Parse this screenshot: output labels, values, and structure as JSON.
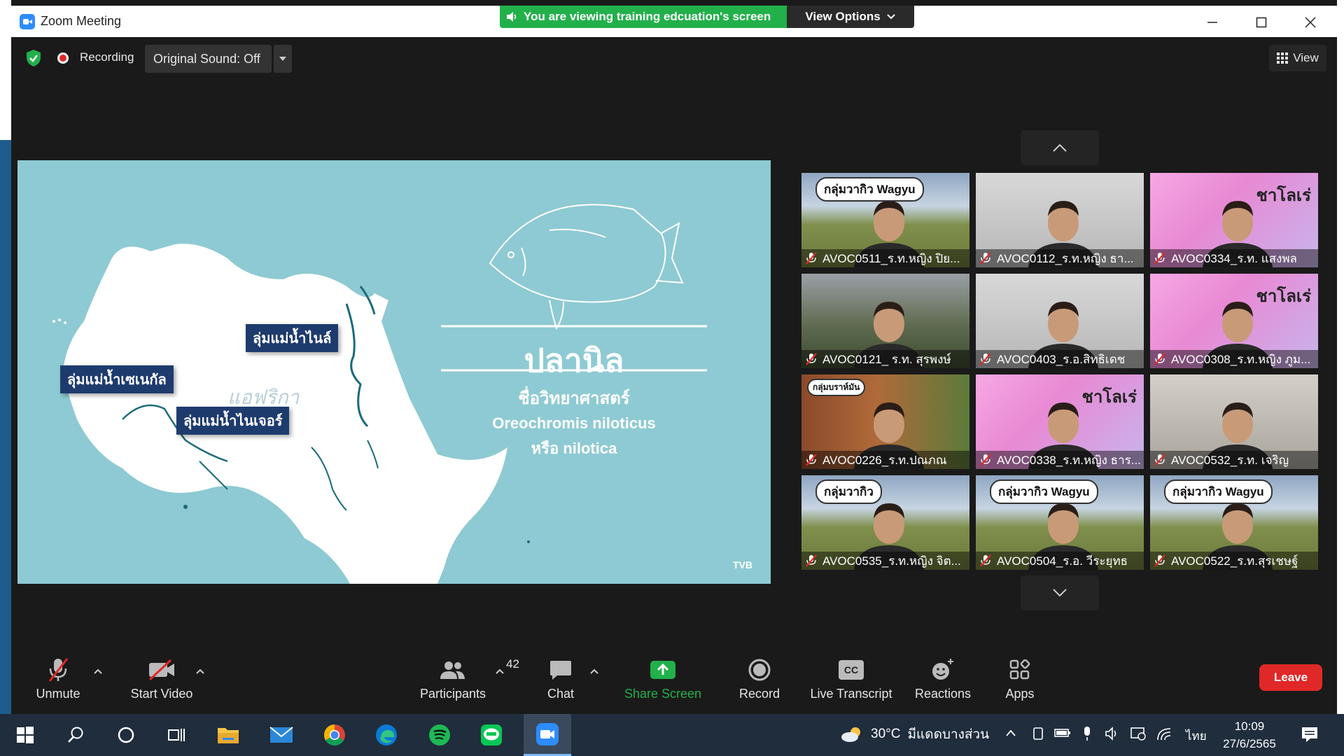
{
  "window": {
    "title": "Zoom Meeting",
    "controls": [
      "minimize",
      "maximize",
      "close"
    ]
  },
  "banner": {
    "viewing_text": "You are viewing training edcuation's screen",
    "view_options_label": "View Options"
  },
  "top_toolbar": {
    "recording_label": "Recording",
    "original_sound_label": "Original Sound: Off",
    "view_label": "View"
  },
  "shared_slide": {
    "map_labels": [
      "ลุ่มแม่น้ำไนล์",
      "ลุ่มแม่น้ำเซเนกัล",
      "ลุ่มแม่น้ำไนเจอร์"
    ],
    "region_label": "แอฟริกา",
    "fish_name": "ปลานิล",
    "sci_heading": "ชื่อวิทยาศาสตร์",
    "sci_name_1": "Oreochromis niloticus",
    "sci_name_2": "หรือ nilotica",
    "watermark": "TVB"
  },
  "gallery": {
    "participants": [
      {
        "name": "AVOC0511_ร.ท.หญิง ปิย...",
        "bg": "wagyu",
        "sign": "กลุ่มวากิว Wagyu"
      },
      {
        "name": "AVOC0112_ร.ท.หญิง ธา...",
        "bg": "room",
        "sign": ""
      },
      {
        "name": "AVOC0334_ร.ท. แสงพล",
        "bg": "pink",
        "sign": "ชาโลเร่"
      },
      {
        "name": "AVOC0121_ ร.ท. สุรพงษ์",
        "bg": "bull",
        "sign": ""
      },
      {
        "name": "AVOC0403_ร.อ.สิทธิเดช",
        "bg": "room",
        "sign": ""
      },
      {
        "name": "AVOC0308_ร.ท.หญิง ภูม...",
        "bg": "pink",
        "sign": "ชาโลเร่"
      },
      {
        "name": "AVOC0226_ร.ท.ปณภณ",
        "bg": "brahman",
        "sign": "กลุ่มบราห์มัน"
      },
      {
        "name": "AVOC0338_ร.ท.หญิง ธาร...",
        "bg": "pink",
        "sign": "ชาโลเร่"
      },
      {
        "name": "AVOC0532_ร.ท. เจริญ",
        "bg": "office",
        "sign": ""
      },
      {
        "name": "AVOC0535_ร.ท.หญิง จิต...",
        "bg": "wagyu",
        "sign": "กลุ่มวากิว"
      },
      {
        "name": "AVOC0504_ร.อ. วีระยุทธ",
        "bg": "wagyu",
        "sign": "กลุ่มวากิว Wagyu"
      },
      {
        "name": "AVOC0522_ร.ท.สุรเชษฐ์",
        "bg": "wagyu",
        "sign": "กลุ่มวากิว Wagyu"
      }
    ]
  },
  "bottom_toolbar": {
    "unmute": "Unmute",
    "start_video": "Start Video",
    "participants": "Participants",
    "participant_count": "42",
    "chat": "Chat",
    "share_screen": "Share Screen",
    "record": "Record",
    "live_transcript": "Live Transcript",
    "cc_badge": "CC",
    "reactions": "Reactions",
    "apps": "Apps",
    "leave": "Leave"
  },
  "taskbar": {
    "weather_temp": "30°C",
    "weather_text": "มีแดดบางส่วน",
    "language": "ไทย",
    "time": "10:09",
    "date": "27/6/2565"
  },
  "colors": {
    "zoom_blue": "#2d8cff",
    "banner_green": "#22b04b",
    "leave_red": "#e02828",
    "share_green": "#22b04b",
    "slide_bg": "#8ecad3",
    "map_label_bg": "#1e3b6e"
  }
}
